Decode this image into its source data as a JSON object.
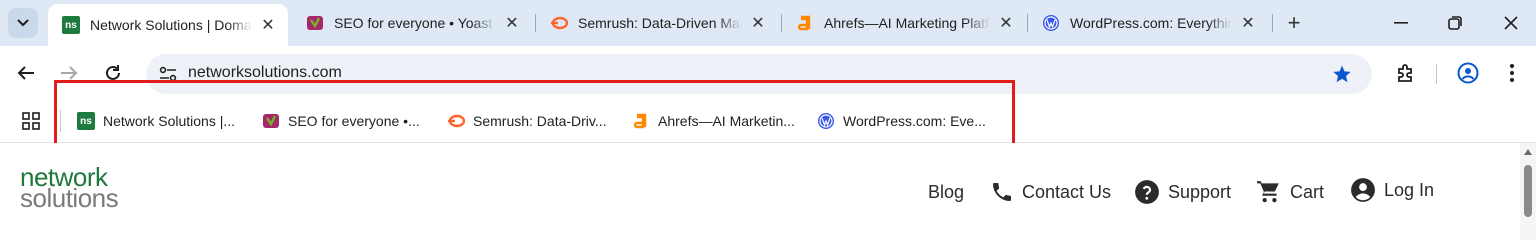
{
  "tabs": [
    {
      "title": "Network Solutions | Domain Names, Web Hosting",
      "favicon": "ns-icon",
      "active": true
    },
    {
      "title": "SEO for everyone • Yoast",
      "favicon": "yoast-icon",
      "active": false
    },
    {
      "title": "Semrush: Data-Driven Marketing Tools",
      "favicon": "semrush-icon",
      "active": false
    },
    {
      "title": "Ahrefs—AI Marketing Platform",
      "favicon": "ahrefs-icon",
      "active": false
    },
    {
      "title": "WordPress.com: Everything you need",
      "favicon": "wordpress-icon",
      "active": false
    }
  ],
  "ns_favicon_text": "ns",
  "address_bar": {
    "url": "networksolutions.com"
  },
  "bookmarks": [
    {
      "label": "Network Solutions |...",
      "favicon": "ns-icon"
    },
    {
      "label": "SEO for everyone •...",
      "favicon": "yoast-icon"
    },
    {
      "label": "Semrush: Data-Driv...",
      "favicon": "semrush-icon"
    },
    {
      "label": "Ahrefs—AI Marketin...",
      "favicon": "ahrefs-icon"
    },
    {
      "label": "WordPress.com: Eve...",
      "favicon": "wordpress-icon"
    }
  ],
  "site": {
    "logo_line1": "network",
    "logo_line2": "solutions",
    "nav": [
      {
        "label": "Blog",
        "icon": ""
      },
      {
        "label": "Contact Us",
        "icon": "phone-icon"
      },
      {
        "label": "Support",
        "icon": "help-icon"
      },
      {
        "label": "Cart",
        "icon": "cart-icon"
      },
      {
        "label": "Log In",
        "icon": "account-icon"
      }
    ]
  },
  "colors": {
    "highlight": "#e21b1b",
    "brand_green": "#1e7a3e",
    "tabstrip": "#dfe9f5",
    "accent_blue": "#0b57d0"
  }
}
